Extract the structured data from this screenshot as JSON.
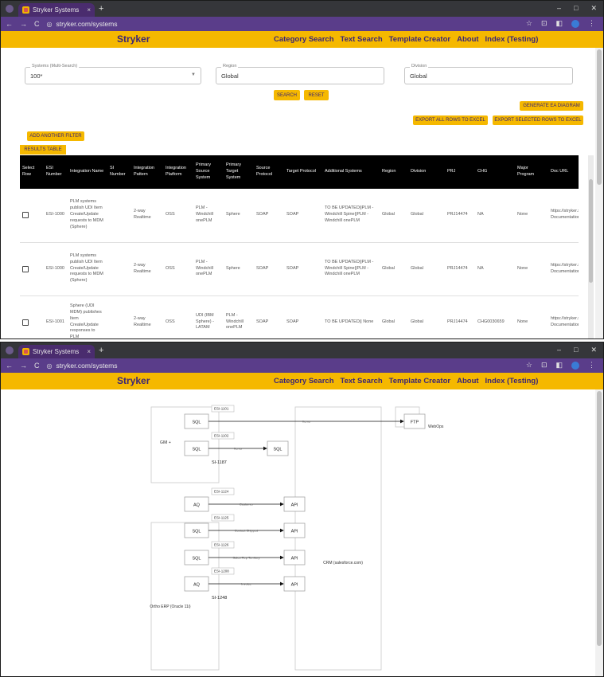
{
  "browser": {
    "tab_title": "Stryker Systems",
    "tab_close": "×",
    "new_tab": "+",
    "url": "stryker.com/systems",
    "back": "←",
    "forward": "→",
    "reload": "C",
    "minimize": "–",
    "maximize": "□",
    "close": "✕",
    "star": "☆",
    "extensions": "⊡",
    "sidebar": "◧",
    "menu": "⋮"
  },
  "header": {
    "brand": "Stryker",
    "menu": [
      "Category Search",
      "Text Search",
      "Template Creator",
      "About",
      "Index (Testing)"
    ]
  },
  "filters": {
    "systems_label": "Systems (Multi-Search)",
    "systems_value": "100*",
    "region_label": "Region",
    "region_value": "Global",
    "division_label": "Division",
    "division_value": "Global",
    "search_label": "SEARCH",
    "reset_label": "RESET",
    "generate_label": "GENERATE EA DIAGRAM",
    "export_all_label": "EXPORT ALL ROWS TO EXCEL",
    "export_selected_label": "EXPORT SELECTED ROWS TO EXCEL",
    "add_filter_label": "ADD ANOTHER FILTER",
    "results_tab_label": "RESULTS TABLE"
  },
  "table": {
    "headers": [
      "Select Row",
      "ESI Number",
      "Integration Name",
      "SI Number",
      "Integration Pattern",
      "Integration Platform",
      "Primary Source System",
      "Primary Target System",
      "Source Protocol",
      "Target Protocol",
      "Additional Systems",
      "Region",
      "Division",
      "PRJ",
      "CHG",
      "Major Program",
      "Doc URL"
    ],
    "rows": [
      [
        "",
        "ESI-1000",
        "PLM systems publish UDI Item Create/Update requests to MDM (Sphere)",
        "",
        "2-way Realtime",
        "OSS",
        "PLM - Windchill onePLM",
        "Sphere",
        "SOAP",
        "SOAP",
        "TO BE UPDATED||PLM - Windchill Spine||PLM - Windchill onePLM",
        "Global",
        "Global",
        "PRJ14474",
        "NA",
        "None",
        "https://stryker.shar Documentation/ES"
      ],
      [
        "",
        "ESI-1000",
        "PLM systems publish UDI Item Create/Update requests to MDM (Sphere)",
        "",
        "2-way Realtime",
        "OSS",
        "PLM - Windchill onePLM",
        "Sphere",
        "SOAP",
        "SOAP",
        "TO BE UPDATED||PLM - Windchill Spine||PLM - Windchill onePLM",
        "Global",
        "Global",
        "PRJ14474",
        "NA",
        "None",
        "https://stryker.shar Documentation/ES"
      ],
      [
        "",
        "ESI-1001",
        "Sphere (UDI MDM) publishes Item Create/Update responses to PLM",
        "",
        "2-way Realtime",
        "OSS",
        "UDI (IBM Sphere) - LATAM",
        "PLM - Windchill onePLM",
        "SOAP",
        "SOAP",
        "TO BE UPDATED|| None",
        "Global",
        "Global",
        "PRJ14474",
        "CHG0030659",
        "None",
        "https://stryker.shar Documentation/ES"
      ]
    ]
  },
  "diagram": {
    "groups": [
      {
        "label": "GIM +"
      },
      {
        "label": "Ortho ERP (Oracle 11i)"
      }
    ],
    "targets": [
      {
        "label": "WebOps"
      },
      {
        "label": "CRM (salesforce.com)"
      }
    ],
    "flows": [
      {
        "esi": "ESI-1101",
        "si": "SI-1145",
        "source": "SQL",
        "target": "FTP",
        "message": "Items"
      },
      {
        "esi": "ESI-1102",
        "si": "SI-1187",
        "source": "SQL",
        "target": "SQL",
        "message": "Items"
      },
      {
        "esi": "ESI-1124",
        "si": "SI-1088",
        "source": "AQ",
        "target": "API",
        "message": "Customer"
      },
      {
        "esi": "ESI-1125",
        "si": "SI-1095",
        "source": "SQL",
        "target": "API",
        "message": "Contact Shipped"
      },
      {
        "esi": "ESI-1126",
        "si": "SI-1097",
        "source": "SQL",
        "target": "API",
        "message": "Sales Rep Territory"
      },
      {
        "esi": "ESI-1208",
        "si": "SI-1248",
        "source": "AQ",
        "target": "API",
        "message": "Invoice"
      }
    ]
  }
}
